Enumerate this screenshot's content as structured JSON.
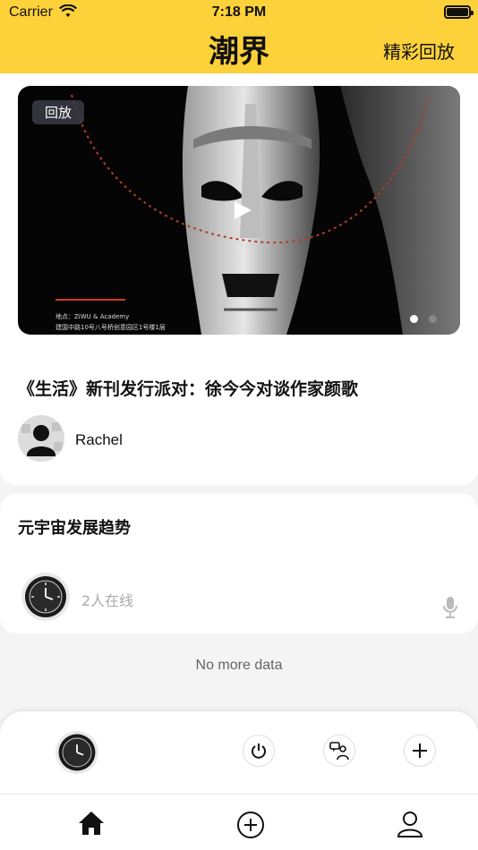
{
  "status_bar": {
    "carrier": "Carrier",
    "time": "7:18 PM"
  },
  "header": {
    "title": "潮界",
    "replay_link": "精彩回放"
  },
  "featured": {
    "badge": "回放",
    "venue_line1": "地点：ZiWU & Academy",
    "venue_line2": "建国中路10号八号桥创意园区1号楼1层",
    "title": "《生活》新刊发行派对：徐今今对谈作家颜歌",
    "author": "Rachel",
    "carousel_active_index": 0,
    "carousel_count": 2
  },
  "live": {
    "title": "元宇宙发展趋势",
    "online_text": "2人在线"
  },
  "footer_text": "No more data",
  "icons": {
    "status": [
      "wifi-icon",
      "battery-icon"
    ],
    "banner": [
      "play-icon"
    ],
    "live": [
      "microphone-icon"
    ],
    "controls": [
      "power-icon",
      "chat-person-icon",
      "plus-icon"
    ],
    "tabs": [
      "home-icon",
      "add-circle-icon",
      "profile-icon"
    ]
  },
  "colors": {
    "header_bg": "#fdd13a",
    "accent_line": "#d23a2a"
  }
}
